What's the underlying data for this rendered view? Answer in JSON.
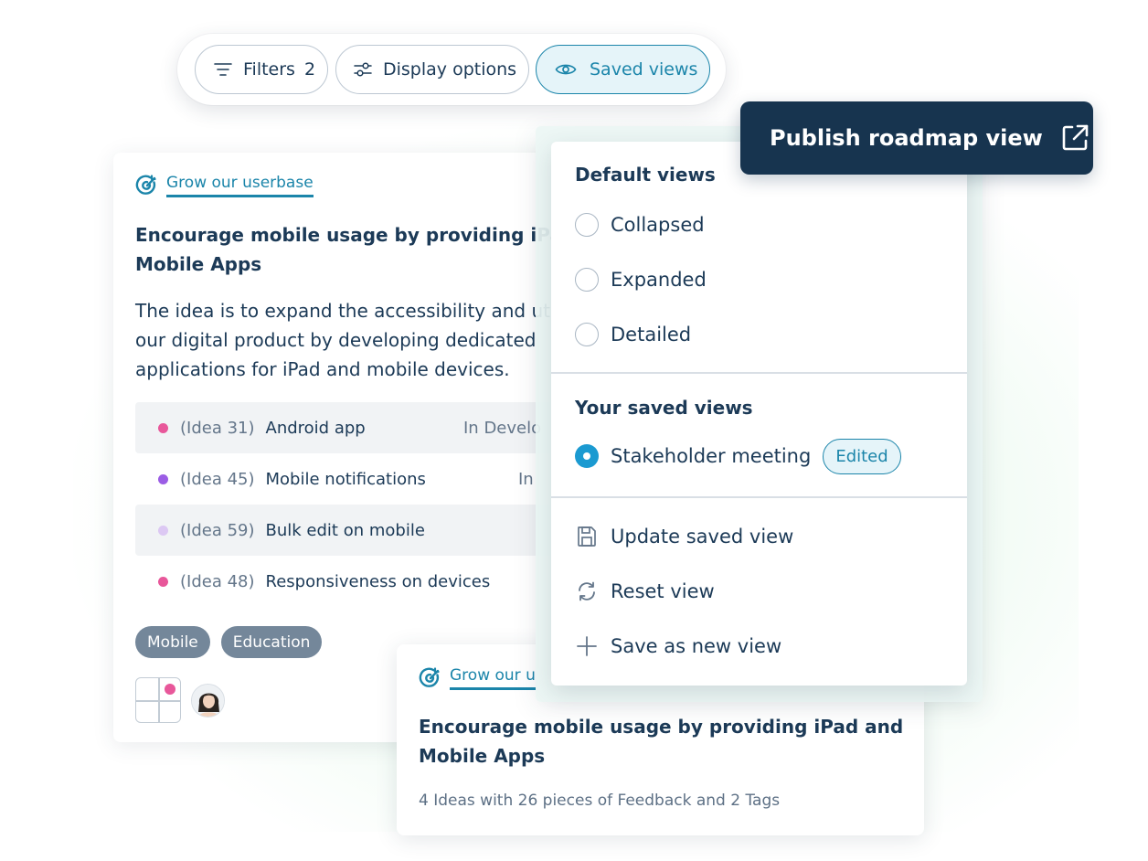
{
  "toolbar": {
    "filters_label": "Filters",
    "filters_count": "2",
    "display_label": "Display options",
    "saved_label": "Saved views"
  },
  "publish": {
    "label": "Publish roadmap view"
  },
  "main_card": {
    "goal": "Grow our userbase",
    "title_line1": "Encourage mobile usage by providing iPad",
    "title_line2": "Mobile Apps",
    "desc_line1": "The idea is to expand the accessibility and ut",
    "desc_line2": "our digital product by developing dedicated",
    "desc_line3": "applications for iPad and mobile devices.",
    "ideas": [
      {
        "id": "(Idea 31)",
        "name": "Android app",
        "status": "In Develo",
        "color": "#e8579a"
      },
      {
        "id": "(Idea 45)",
        "name": "Mobile notifications",
        "status": "In",
        "color": "#9b5de5"
      },
      {
        "id": "(Idea 59)",
        "name": "Bulk edit on mobile",
        "status": "",
        "color": "#dcc8f3"
      },
      {
        "id": "(Idea 48)",
        "name": "Responsiveness on devices",
        "status": "",
        "color": "#e8579a"
      }
    ],
    "tags": [
      "Mobile",
      "Education"
    ]
  },
  "second_card": {
    "goal": "Grow our u",
    "title_line1": "Encourage mobile usage by providing iPad and",
    "title_line2": "Mobile Apps",
    "summary": "4 Ideas with 26 pieces of Feedback and 2 Tags"
  },
  "dropdown": {
    "default_heading": "Default views",
    "default_views": [
      "Collapsed",
      "Expanded",
      "Detailed"
    ],
    "saved_heading": "Your saved views",
    "saved_view": "Stakeholder meeting",
    "edited_badge": "Edited",
    "actions": [
      "Update saved view",
      "Reset view",
      "Save as new view"
    ]
  },
  "colors": {
    "accent": "#1b85aa",
    "navy": "#17344f",
    "radio_selected": "#1b9ad1",
    "tag_bg": "#74879a"
  }
}
